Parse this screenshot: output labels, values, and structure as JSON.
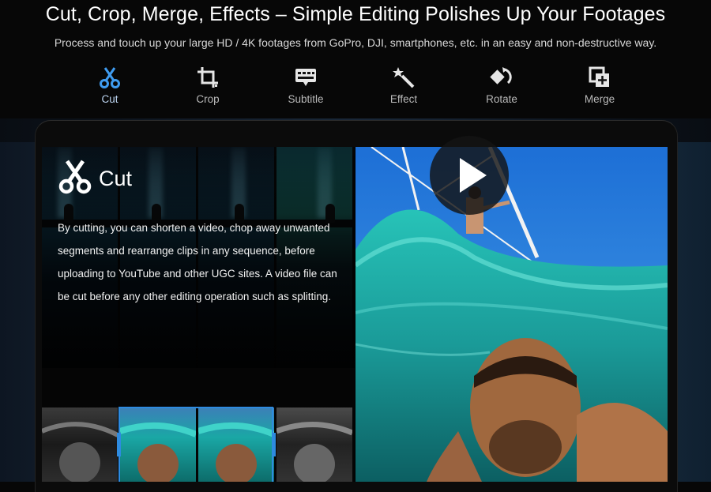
{
  "header": {
    "title": "Cut, Crop, Merge, Effects – Simple Editing Polishes Up Your Footages",
    "subtitle": "Process and touch up your large HD / 4K footages from GoPro, DJI, smartphones, etc. in an easy and non-destructive way."
  },
  "tabs": [
    {
      "label": "Cut",
      "icon": "scissors-icon"
    },
    {
      "label": "Crop",
      "icon": "crop-icon"
    },
    {
      "label": "Subtitle",
      "icon": "subtitle-icon"
    },
    {
      "label": "Effect",
      "icon": "magic-wand-icon"
    },
    {
      "label": "Rotate",
      "icon": "rotate-icon"
    },
    {
      "label": "Merge",
      "icon": "merge-icon"
    }
  ],
  "active_tab": "Cut",
  "feature": {
    "title": "Cut",
    "icon": "scissors-icon",
    "description": "By cutting, you can shorten a video, chop away unwanted segments and rearrange clips in any sequence, before uploading to YouTube and other UGC sites. A video file can be cut before any other editing operation such as splitting."
  },
  "player": {
    "icon": "play-icon"
  },
  "colors": {
    "accent": "#2e8be0",
    "active_tab_icon": "#3f9cf0",
    "water": "#1fb5b0"
  }
}
